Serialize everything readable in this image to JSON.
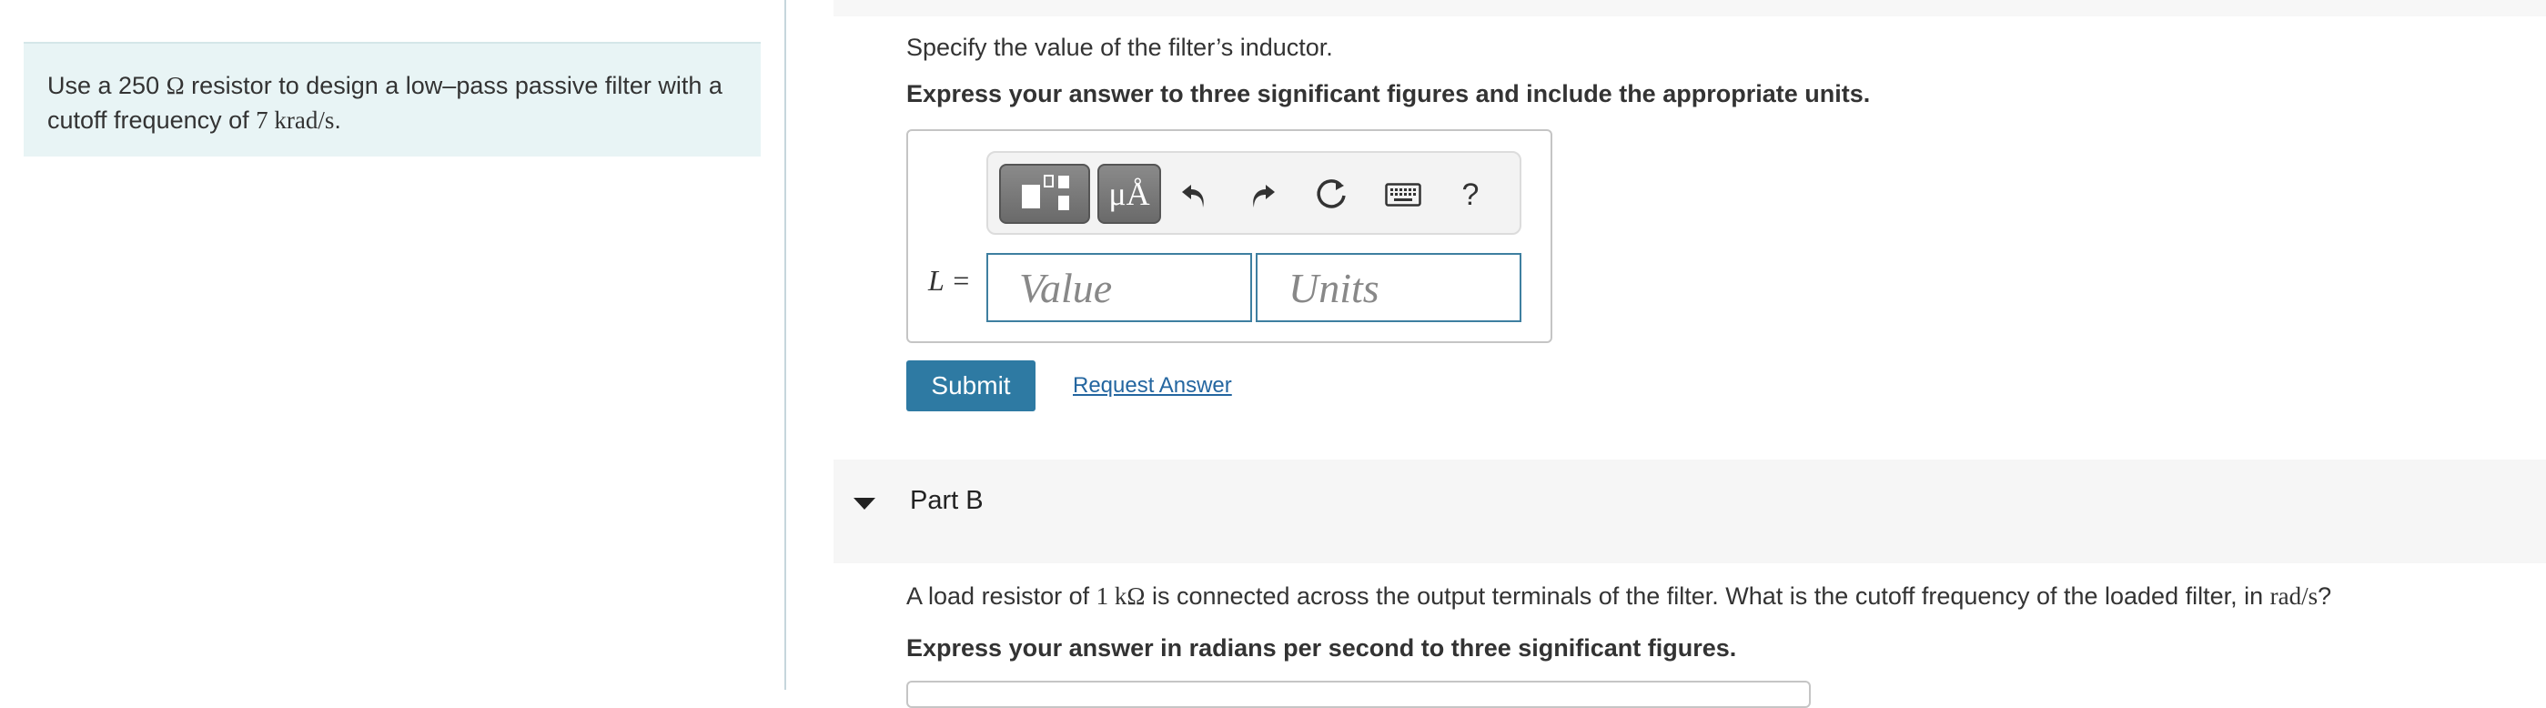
{
  "problem": {
    "text_before": "Use a 250 ",
    "resistor_unit": "Ω",
    "text_middle": " resistor to design a low–pass passive filter with a cutoff frequency of ",
    "cutoff_value": "7 krad/s",
    "text_after": "."
  },
  "part_a": {
    "prompt": "Specify the value of the filter’s inductor.",
    "instruction": "Express your answer to three significant figures and include the appropriate units.",
    "variable_label": "L =",
    "value_placeholder": "Value",
    "units_placeholder": "Units",
    "toolbar": {
      "templates_icon": "templates-icon",
      "units_button_label": "μÅ",
      "undo_icon": "undo-icon",
      "redo_icon": "redo-icon",
      "reset_icon": "reset-icon",
      "keyboard_icon": "keyboard-icon",
      "help_label": "?"
    },
    "submit_label": "Submit",
    "request_answer_label": "Request Answer"
  },
  "part_b": {
    "title": "Part B",
    "question_before": "A load resistor of ",
    "load_value": "1 kΩ",
    "question_middle": " is connected across the output terminals of the filter. What is the cutoff frequency of the loaded filter, in ",
    "unit": "rad/s",
    "question_after": "?",
    "instruction": "Express your answer in radians per second to three significant figures."
  },
  "colors": {
    "problem_bg": "#e8f4f5",
    "submit_bg": "#2e7aa3",
    "link": "#2466a0",
    "field_border": "#3e7fa0"
  }
}
